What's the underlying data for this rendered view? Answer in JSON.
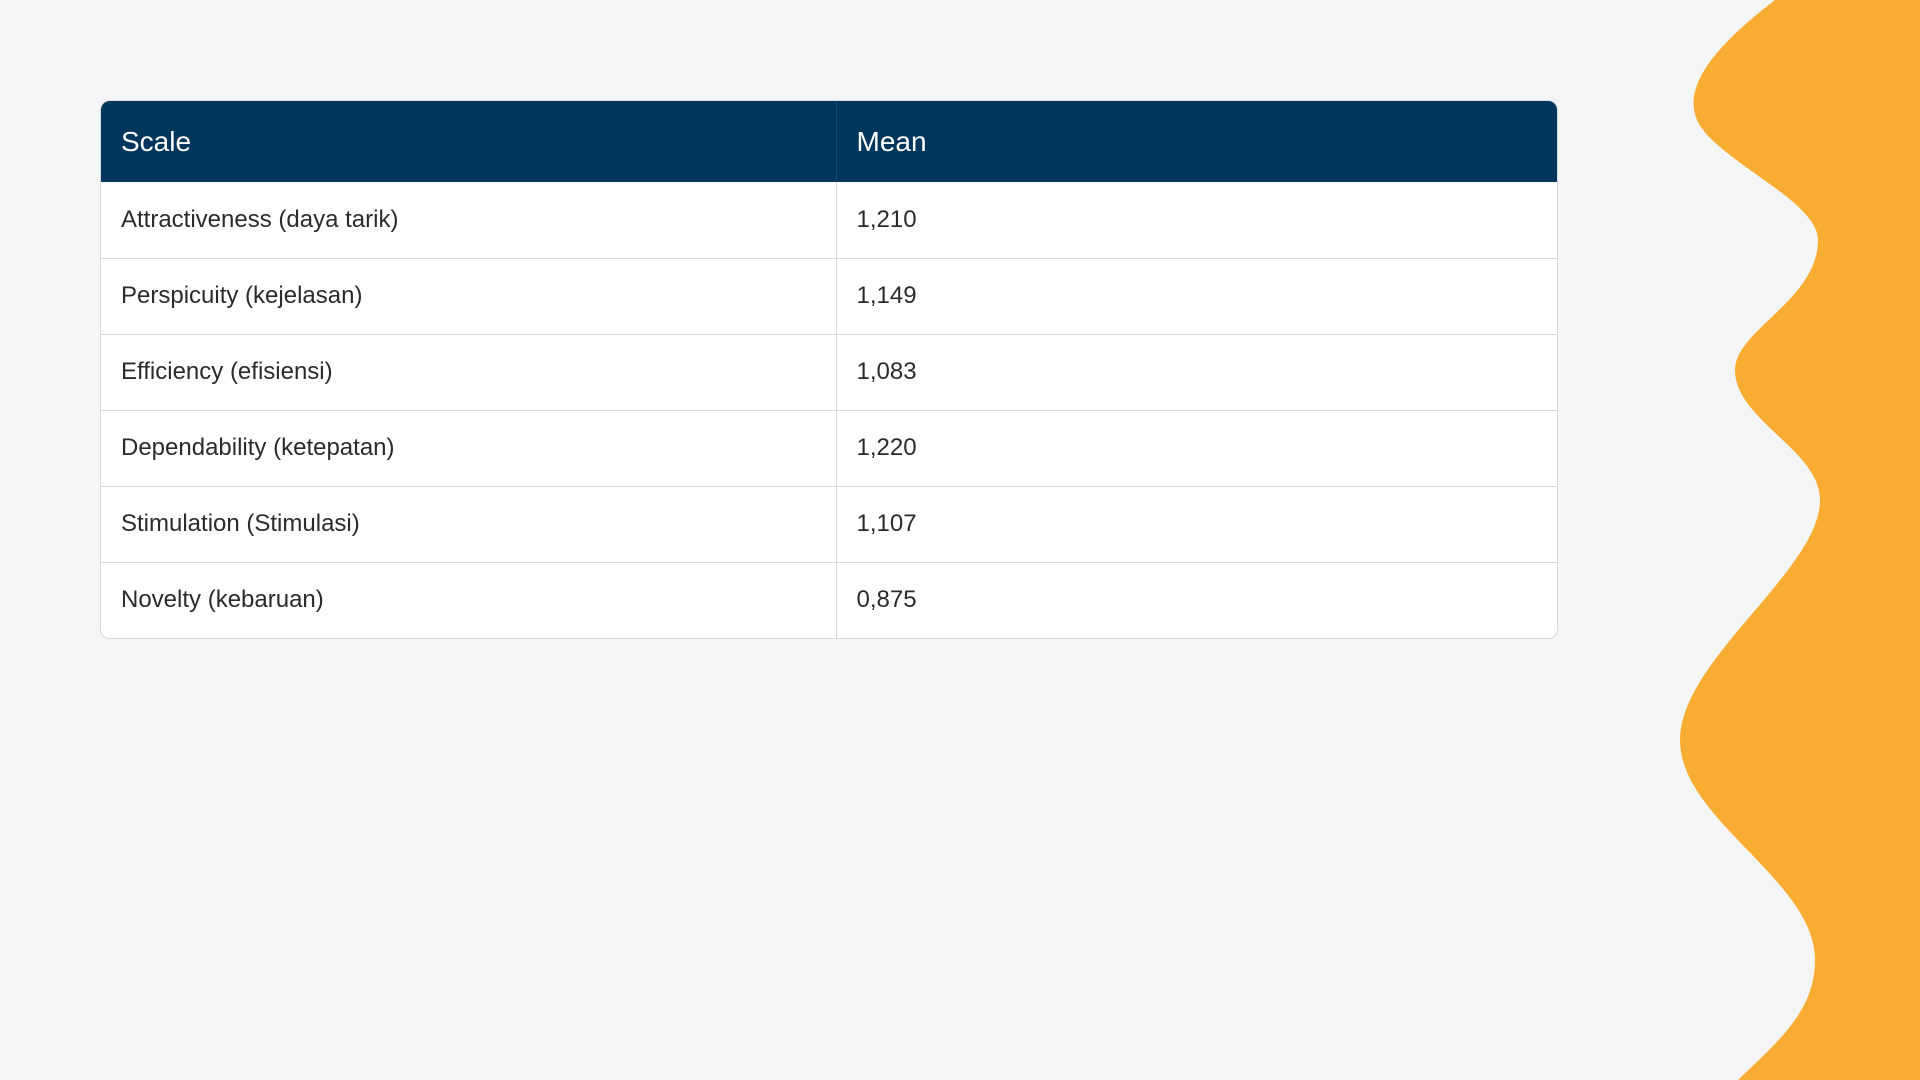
{
  "colors": {
    "background": "#f4f5f7",
    "header_bg": "#00355c",
    "header_text": "#ffffff",
    "accent_wave": "#f8ad32",
    "cell_text": "#2b2b2b",
    "border": "#d7d9dc"
  },
  "table": {
    "headers": [
      "Scale",
      "Mean"
    ],
    "rows": [
      [
        "Attractiveness (daya tarik)",
        "1,210"
      ],
      [
        "Perspicuity (kejelasan)",
        "1,149"
      ],
      [
        "Efficiency (efisiensi)",
        "1,083"
      ],
      [
        "Dependability (ketepatan)",
        "1,220"
      ],
      [
        "Stimulation (Stimulasi)",
        "1,107"
      ],
      [
        "Novelty (kebaruan)",
        "0,875"
      ]
    ]
  }
}
